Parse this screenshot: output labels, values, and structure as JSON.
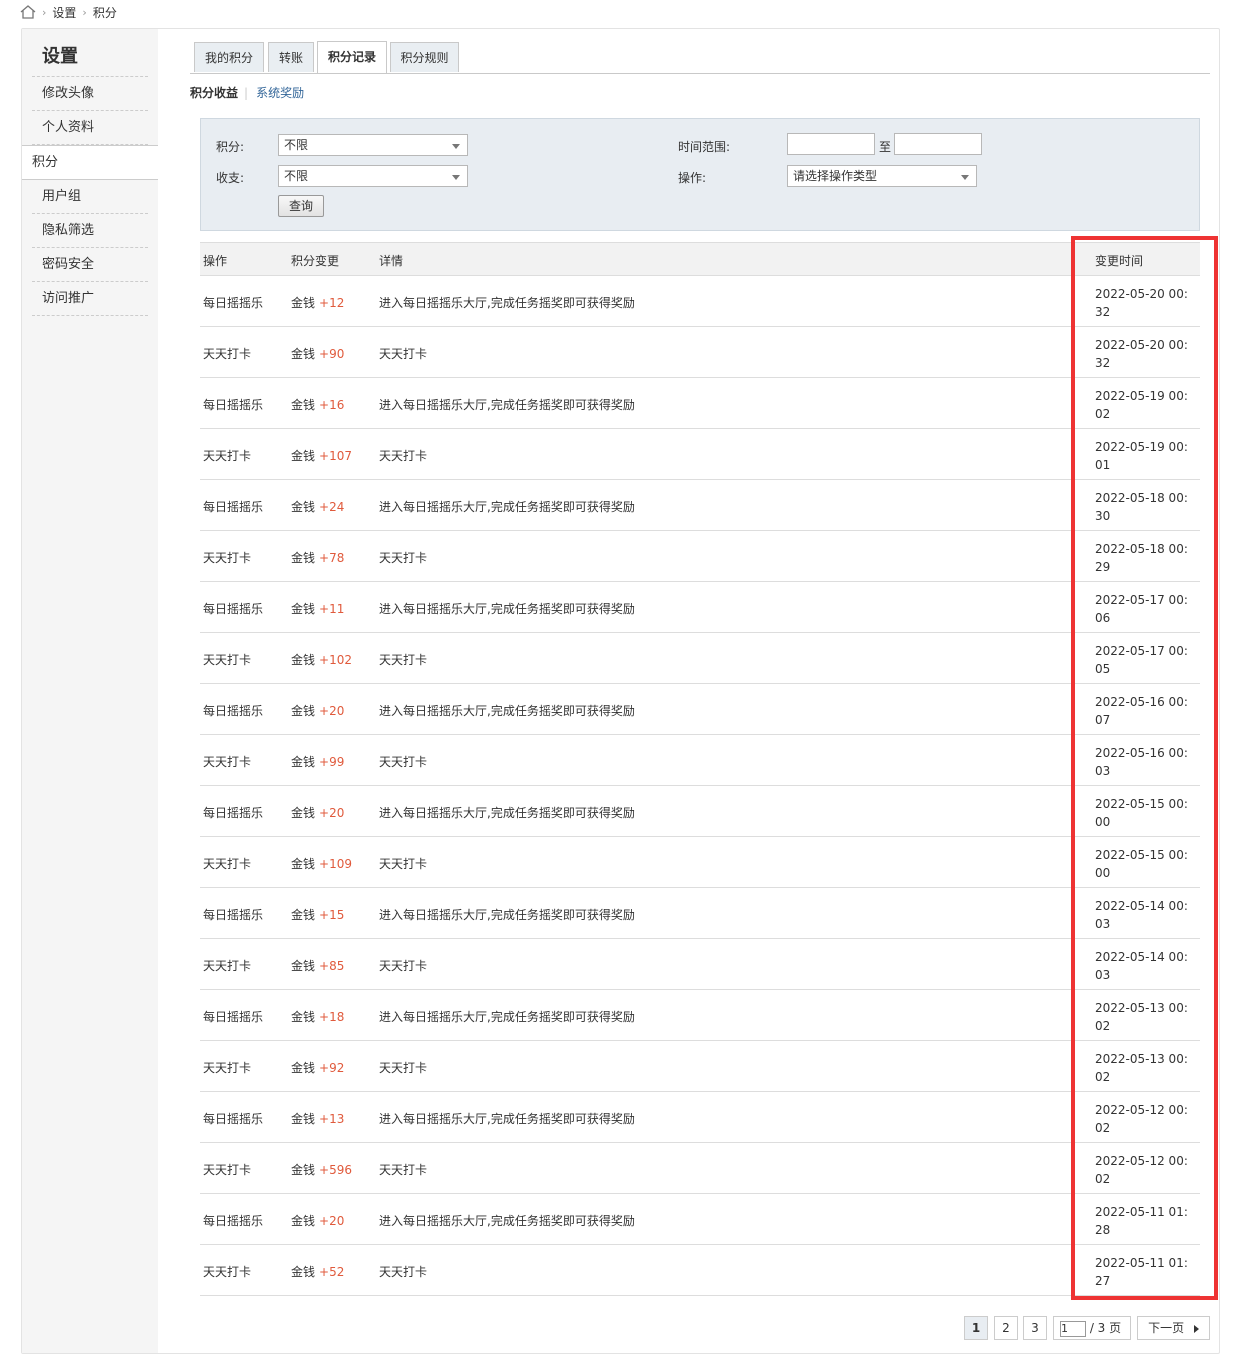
{
  "breadcrumb": {
    "items": [
      "设置",
      "积分"
    ]
  },
  "sidebar": {
    "title": "设置",
    "items": [
      {
        "label": "修改头像"
      },
      {
        "label": "个人资料"
      },
      {
        "label": "积分"
      },
      {
        "label": "用户组"
      },
      {
        "label": "隐私筛选"
      },
      {
        "label": "密码安全"
      },
      {
        "label": "访问推广"
      }
    ],
    "active_index": 2
  },
  "tabs": [
    {
      "label": "我的积分"
    },
    {
      "label": "转账"
    },
    {
      "label": "积分记录"
    },
    {
      "label": "积分规则"
    }
  ],
  "subnav": {
    "active": "积分收益",
    "other": "系统奖励"
  },
  "filter": {
    "points_label": "积分:",
    "points_value": "不限",
    "income_label": "收支:",
    "income_value": "不限",
    "time_label": "时间范围:",
    "time_sep": "至",
    "op_label": "操作:",
    "op_value": "请选择操作类型",
    "query_label": "查询"
  },
  "table": {
    "headers": [
      "操作",
      "积分变更",
      "详情",
      "变更时间"
    ],
    "rows": [
      {
        "op": "每日摇摇乐",
        "cur": "金钱",
        "amt": "+12",
        "detail": "进入每日摇摇乐大厅,完成任务摇奖即可获得奖励",
        "time": "2022-05-20 00:32"
      },
      {
        "op": "天天打卡",
        "cur": "金钱",
        "amt": "+90",
        "detail": "天天打卡",
        "time": "2022-05-20 00:32"
      },
      {
        "op": "每日摇摇乐",
        "cur": "金钱",
        "amt": "+16",
        "detail": "进入每日摇摇乐大厅,完成任务摇奖即可获得奖励",
        "time": "2022-05-19 00:02"
      },
      {
        "op": "天天打卡",
        "cur": "金钱",
        "amt": "+107",
        "detail": "天天打卡",
        "time": "2022-05-19 00:01"
      },
      {
        "op": "每日摇摇乐",
        "cur": "金钱",
        "amt": "+24",
        "detail": "进入每日摇摇乐大厅,完成任务摇奖即可获得奖励",
        "time": "2022-05-18 00:30"
      },
      {
        "op": "天天打卡",
        "cur": "金钱",
        "amt": "+78",
        "detail": "天天打卡",
        "time": "2022-05-18 00:29"
      },
      {
        "op": "每日摇摇乐",
        "cur": "金钱",
        "amt": "+11",
        "detail": "进入每日摇摇乐大厅,完成任务摇奖即可获得奖励",
        "time": "2022-05-17 00:06"
      },
      {
        "op": "天天打卡",
        "cur": "金钱",
        "amt": "+102",
        "detail": "天天打卡",
        "time": "2022-05-17 00:05"
      },
      {
        "op": "每日摇摇乐",
        "cur": "金钱",
        "amt": "+20",
        "detail": "进入每日摇摇乐大厅,完成任务摇奖即可获得奖励",
        "time": "2022-05-16 00:07"
      },
      {
        "op": "天天打卡",
        "cur": "金钱",
        "amt": "+99",
        "detail": "天天打卡",
        "time": "2022-05-16 00:03"
      },
      {
        "op": "每日摇摇乐",
        "cur": "金钱",
        "amt": "+20",
        "detail": "进入每日摇摇乐大厅,完成任务摇奖即可获得奖励",
        "time": "2022-05-15 00:00"
      },
      {
        "op": "天天打卡",
        "cur": "金钱",
        "amt": "+109",
        "detail": "天天打卡",
        "time": "2022-05-15 00:00"
      },
      {
        "op": "每日摇摇乐",
        "cur": "金钱",
        "amt": "+15",
        "detail": "进入每日摇摇乐大厅,完成任务摇奖即可获得奖励",
        "time": "2022-05-14 00:03"
      },
      {
        "op": "天天打卡",
        "cur": "金钱",
        "amt": "+85",
        "detail": "天天打卡",
        "time": "2022-05-14 00:03"
      },
      {
        "op": "每日摇摇乐",
        "cur": "金钱",
        "amt": "+18",
        "detail": "进入每日摇摇乐大厅,完成任务摇奖即可获得奖励",
        "time": "2022-05-13 00:02"
      },
      {
        "op": "天天打卡",
        "cur": "金钱",
        "amt": "+92",
        "detail": "天天打卡",
        "time": "2022-05-13 00:02"
      },
      {
        "op": "每日摇摇乐",
        "cur": "金钱",
        "amt": "+13",
        "detail": "进入每日摇摇乐大厅,完成任务摇奖即可获得奖励",
        "time": "2022-05-12 00:02"
      },
      {
        "op": "天天打卡",
        "cur": "金钱",
        "amt": "+596",
        "detail": "天天打卡",
        "time": "2022-05-12 00:02"
      },
      {
        "op": "每日摇摇乐",
        "cur": "金钱",
        "amt": "+20",
        "detail": "进入每日摇摇乐大厅,完成任务摇奖即可获得奖励",
        "time": "2022-05-11 01:28"
      },
      {
        "op": "天天打卡",
        "cur": "金钱",
        "amt": "+52",
        "detail": "天天打卡",
        "time": "2022-05-11 01:27"
      }
    ]
  },
  "pager": {
    "pages": [
      "1",
      "2",
      "3"
    ],
    "current": "1",
    "input_value": "1",
    "total_text": "/ 3 页",
    "next_label": "下一页"
  },
  "colors": {
    "amount": "#e05a3c",
    "highlight": "#ee3333",
    "filter_bg": "#e8edf2"
  }
}
